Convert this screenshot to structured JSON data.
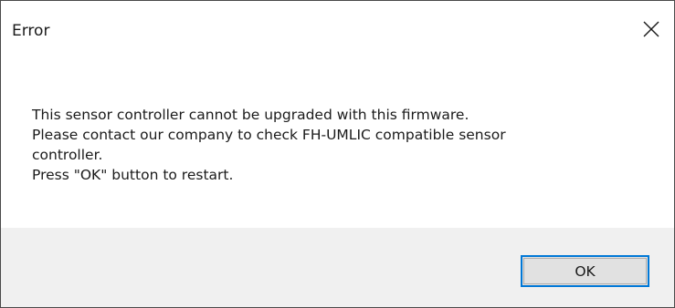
{
  "dialog": {
    "title": "Error",
    "close_icon": "close-icon",
    "message_lines": [
      "This sensor controller cannot be upgraded with this firmware.",
      "Please contact our company to check FH-UMLIC compatible sensor",
      "controller.",
      "Press \"OK\" button to restart."
    ],
    "ok_label": "OK"
  },
  "colors": {
    "footer_background": "#f0f0f0",
    "button_focus_border": "#0078d7",
    "button_face": "#e1e1e1"
  }
}
